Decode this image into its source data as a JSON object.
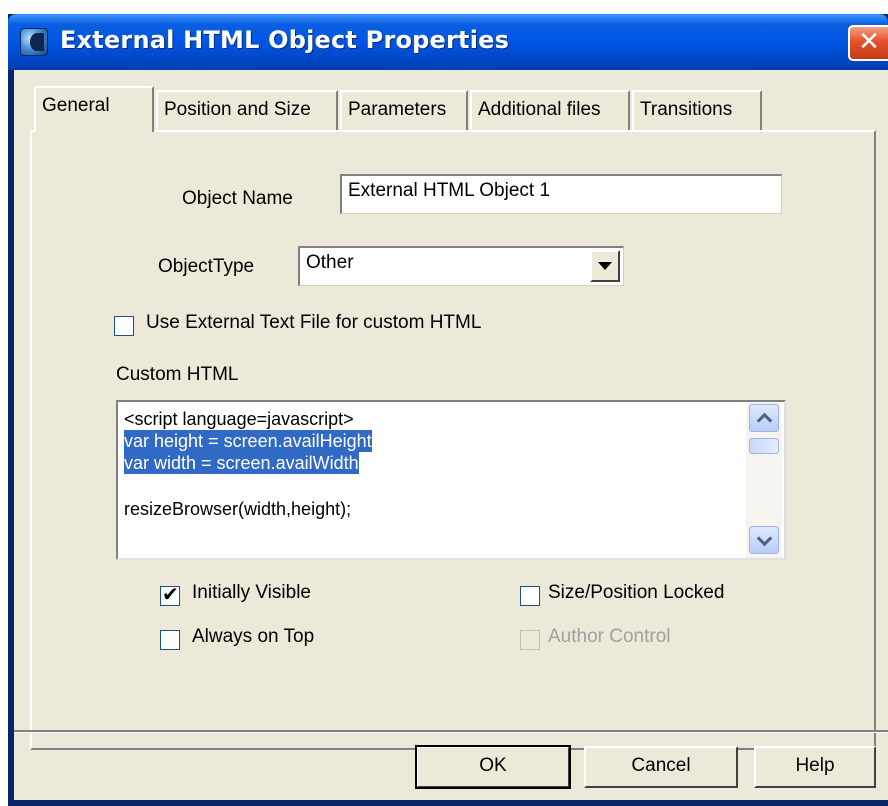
{
  "window": {
    "title": "External HTML Object Properties",
    "close_glyph": "✕"
  },
  "tabs": [
    {
      "label": "General",
      "active": true
    },
    {
      "label": "Position and Size",
      "active": false
    },
    {
      "label": "Parameters",
      "active": false
    },
    {
      "label": "Additional files",
      "active": false
    },
    {
      "label": "Transitions",
      "active": false
    }
  ],
  "general": {
    "object_name_label": "Object Name",
    "object_name_value": "External HTML Object 1",
    "object_type_label": "ObjectType",
    "object_type_value": "Other",
    "use_external_label": "Use External Text File for custom HTML",
    "use_external_checked": false,
    "custom_html_label": "Custom HTML",
    "custom_html_lines": [
      {
        "text": "<script language=javascript>",
        "selected": false
      },
      {
        "text": "var height = screen.availHeight",
        "selected": true
      },
      {
        "text": "var width = screen.availWidth",
        "selected": true
      },
      {
        "text": "",
        "selected": false
      },
      {
        "text": "resizeBrowser(width,height);",
        "selected": false
      }
    ],
    "initially_visible_label": "Initially Visible",
    "initially_visible_checked": true,
    "always_on_top_label": "Always on Top",
    "always_on_top_checked": false,
    "size_locked_label": "Size/Position Locked",
    "size_locked_checked": false,
    "author_control_label": "Author Control",
    "author_control_checked": false,
    "check_glyph": "✔"
  },
  "buttons": {
    "ok": "OK",
    "cancel": "Cancel",
    "help": "Help"
  }
}
